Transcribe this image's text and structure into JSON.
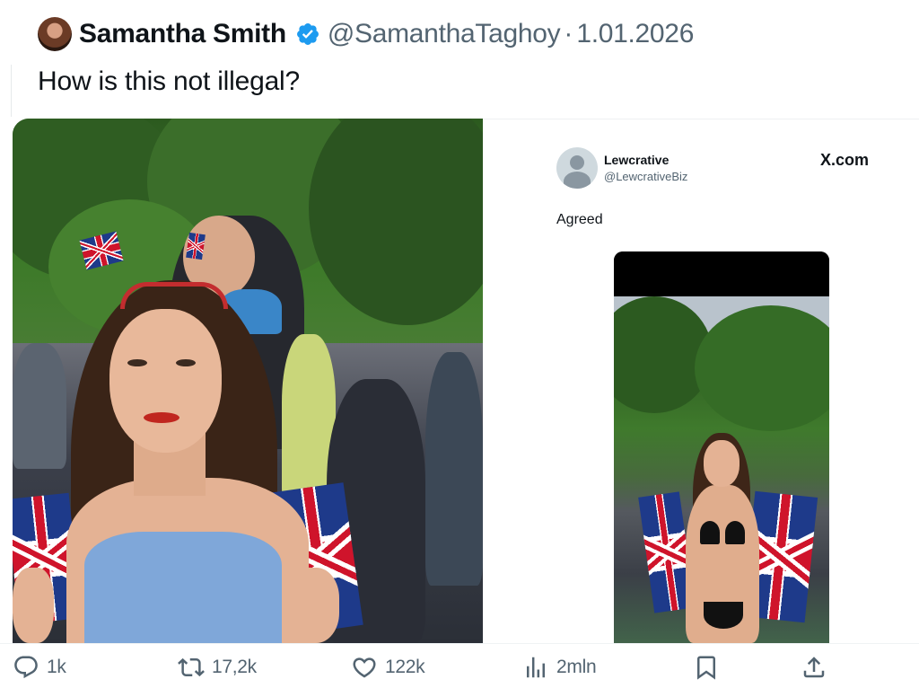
{
  "tweet": {
    "author_name": "Samantha Smith",
    "handle": "@SamanthaTaghoy",
    "separator": "·",
    "date": "1.01.2026",
    "text": "How is this not illegal?",
    "verified": true,
    "colors": {
      "verified_badge": "#1d9bf0",
      "text": "#0f1419",
      "muted": "#536471"
    }
  },
  "embedded_post": {
    "author_name": "Lewcrative",
    "handle": "@LewcrativeBiz",
    "brand": "X.com",
    "text": "Agreed"
  },
  "media": {
    "left_image": "crowd-photo-woman-blue-dress",
    "right_image": "screenshot-of-x-post-with-photo"
  },
  "actions": [
    {
      "name": "reply",
      "icon": "reply-icon",
      "count": "1k"
    },
    {
      "name": "repost",
      "icon": "repost-icon",
      "count": "17,2k"
    },
    {
      "name": "like",
      "icon": "heart-icon",
      "count": "122k"
    },
    {
      "name": "views",
      "icon": "analytics-icon",
      "count": "2mln"
    },
    {
      "name": "bookmark",
      "icon": "bookmark-icon",
      "count": ""
    },
    {
      "name": "share",
      "icon": "share-icon",
      "count": ""
    }
  ]
}
